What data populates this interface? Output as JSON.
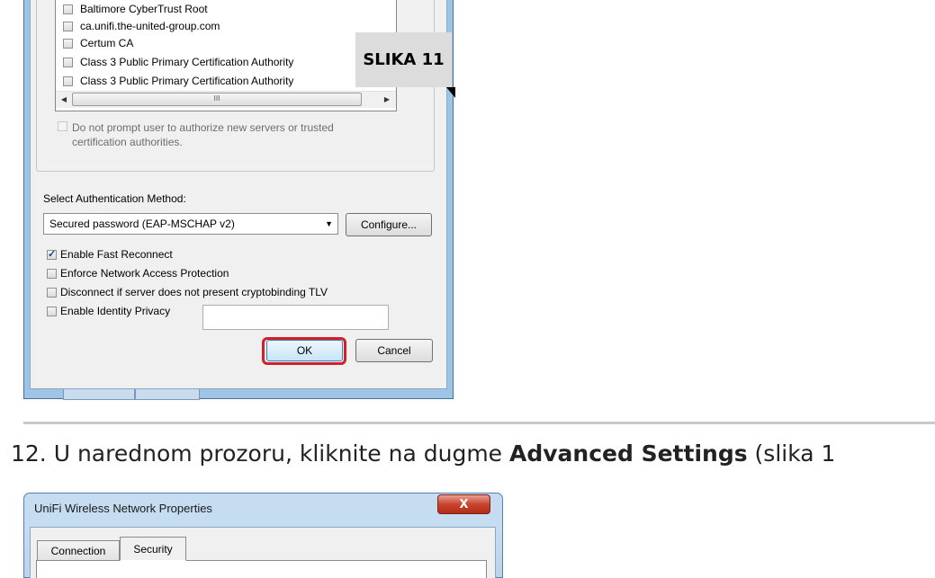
{
  "top_dialog": {
    "trusted_cas": [
      {
        "label": "Baltimore CyberTrust Root",
        "checked": false
      },
      {
        "label": "ca.unifi.the-united-group.com",
        "checked": false
      },
      {
        "label": "Certum CA",
        "checked": false
      },
      {
        "label": "Class 3 Public Primary Certification Authority",
        "checked": false
      },
      {
        "label": "Class 3 Public Primary Certification Authority",
        "checked": false
      }
    ],
    "scroll_grip": "III",
    "no_prompt_label_line1": "Do not prompt user to authorize new servers or trusted",
    "no_prompt_label_line2": "certification authorities.",
    "auth_method_label": "Select Authentication Method:",
    "auth_method_value": "Secured password (EAP-MSCHAP v2)",
    "configure_label": "Configure...",
    "options": [
      {
        "label": "Enable Fast Reconnect",
        "checked": true
      },
      {
        "label": "Enforce Network Access Protection",
        "checked": false
      },
      {
        "label": "Disconnect if server does not present cryptobinding TLV",
        "checked": false
      },
      {
        "label": "Enable Identity Privacy",
        "checked": false
      }
    ],
    "identity_value": "",
    "ok_label": "OK",
    "cancel_label": "Cancel"
  },
  "callout": {
    "label": "SLIKA 11"
  },
  "instruction": {
    "prefix": "12. U narednom prozoru, kliknite na dugme ",
    "bold": "Advanced Settings",
    "suffix": " (slika 1"
  },
  "bottom_dialog": {
    "title": "UniFi Wireless Network Properties",
    "close_glyph": "X",
    "tabs": [
      "Connection",
      "Security"
    ],
    "active_tab": "Security"
  },
  "colors": {
    "highlight": "#d0202a",
    "title_bar": "#c6dcf0",
    "callout_bg": "#dcdcdc"
  }
}
